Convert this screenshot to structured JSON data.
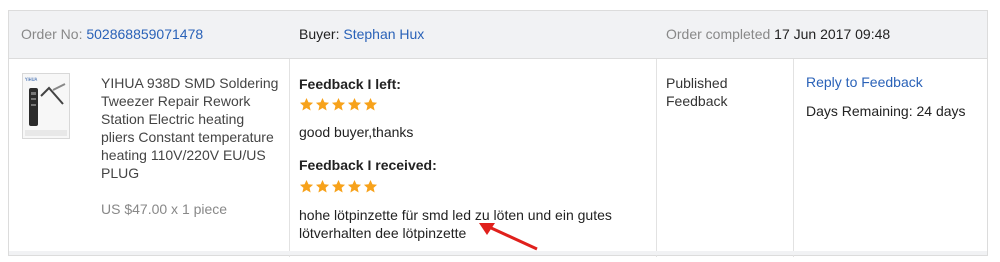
{
  "header": {
    "order_label": "Order No:",
    "order_number": "502868859071478",
    "buyer_label": "Buyer:",
    "buyer_name": "Stephan Hux",
    "completed_label": "Order completed",
    "completed_date": "17 Jun 2017 09:48"
  },
  "product": {
    "title": "YIHUA 938D SMD Soldering Tweezer Repair Rework Station Electric heating pliers Constant temperature heating 110V/220V EU/US PLUG",
    "price": "US $47.00 x 1 piece",
    "thumb_brand": "YIHUA"
  },
  "feedback": {
    "left_title": "Feedback I left:",
    "left_rating": 5,
    "left_text": "good buyer,thanks",
    "received_title": "Feedback I received:",
    "received_rating": 5,
    "received_text": "hohe lötpinzette für smd led zu löten und ein gutes lötverhalten dee lötpinzette"
  },
  "status": {
    "label": "Published Feedback"
  },
  "actions": {
    "reply_label": "Reply to Feedback",
    "days_remaining": "Days Remaining: 24 days"
  },
  "colors": {
    "link": "#2a62b8",
    "star": "#f7a21b",
    "arrow": "#e0201c"
  }
}
